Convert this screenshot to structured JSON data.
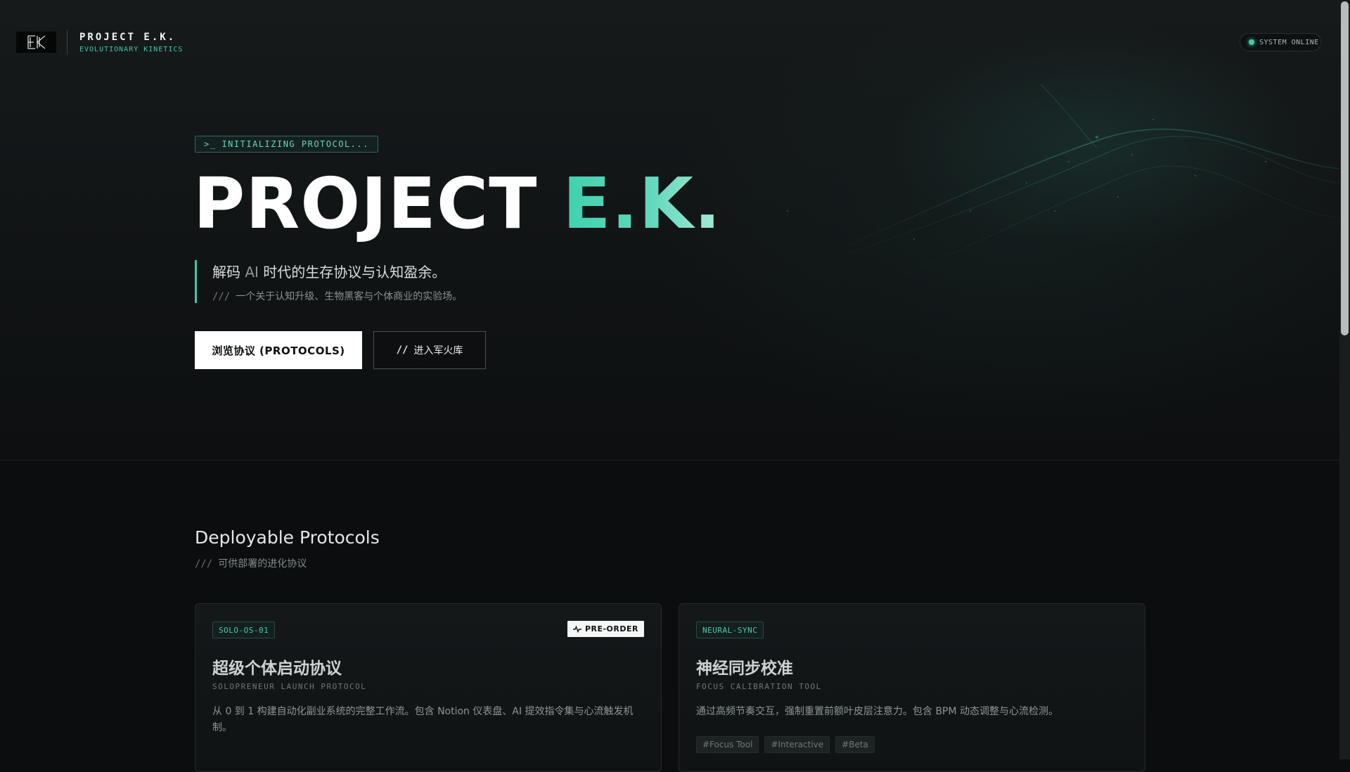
{
  "brand": {
    "logo_icon": "ek-monogram-logo",
    "name": "PROJECT E.K.",
    "subtitle": "EVOLUTIONARY KINETICS"
  },
  "status": {
    "label": "SYSTEM ONLINE",
    "color": "#35d0a8"
  },
  "hero": {
    "init_prompt": ">_",
    "init_tag": "INITIALIZING PROTOCOL...",
    "title_main": "PROJECT ",
    "title_accent": "E.K.",
    "tagline_part1": "解码 ",
    "tagline_part2": "AI",
    "tagline_part3": " 时代的",
    "tagline_part4": "生存协议与认知盈余。",
    "tagline_sub_prefix": "///",
    "tagline_sub": "一个关于认知升级、生物黑客与个体商业的实验场。",
    "primary_button": "浏览协议 (PROTOCOLS)",
    "secondary_button_prefix": "//",
    "secondary_button": "进入军火库"
  },
  "protocols": {
    "title": "Deployable Protocols",
    "subtitle_prefix": "///",
    "subtitle": "可供部署的进化协议",
    "cards": [
      {
        "code": "SOLO-OS-01",
        "badge_icon": "pulse-icon",
        "badge": "PRE-ORDER",
        "title": "超级个体启动协议",
        "subtitle": "SOLOPRENEUR LAUNCH PROTOCOL",
        "description": "从 0 到 1 构建自动化副业系统的完整工作流。包含 Notion 仪表盘、AI 提效指令集与心流触发机制。"
      },
      {
        "code": "NEURAL-SYNC",
        "title": "神经同步校准",
        "subtitle": "FOCUS CALIBRATION TOOL",
        "description": "通过高频节奏交互，强制重置前额叶皮层注意力。包含 BPM 动态调整与心流检测。",
        "tags": [
          "#Focus Tool",
          "#Interactive",
          "#Beta"
        ]
      }
    ]
  },
  "colors": {
    "accent": "#3fc7a9",
    "background": "#0b0d0e"
  }
}
